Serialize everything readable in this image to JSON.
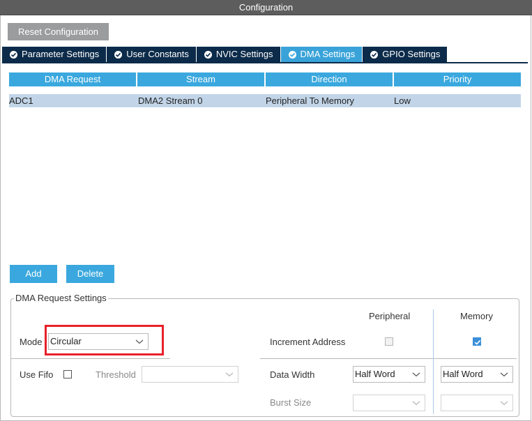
{
  "window": {
    "title": "Configuration"
  },
  "toolbar": {
    "reset_label": "Reset Configuration"
  },
  "tabs": [
    {
      "label": "Parameter Settings",
      "active": false
    },
    {
      "label": "User Constants",
      "active": false
    },
    {
      "label": "NVIC Settings",
      "active": false
    },
    {
      "label": "DMA Settings",
      "active": true
    },
    {
      "label": "GPIO Settings",
      "active": false
    }
  ],
  "table": {
    "columns": [
      "DMA Request",
      "Stream",
      "Direction",
      "Priority"
    ],
    "rows": [
      [
        "ADC1",
        "DMA2 Stream 0",
        "Peripheral To Memory",
        "Low"
      ]
    ]
  },
  "actions": {
    "add_label": "Add",
    "delete_label": "Delete"
  },
  "settings": {
    "group_title": "DMA Request Settings",
    "peripheral_header": "Peripheral",
    "memory_header": "Memory",
    "mode_label": "Mode",
    "mode_value": "Circular",
    "increment_label": "Increment Address",
    "peripheral_increment": false,
    "memory_increment": true,
    "use_fifo_label": "Use Fifo",
    "use_fifo": false,
    "threshold_label": "Threshold",
    "threshold_value": "",
    "data_width_label": "Data Width",
    "peripheral_data_width": "Half Word",
    "memory_data_width": "Half Word",
    "burst_size_label": "Burst Size",
    "peripheral_burst_size": "",
    "memory_burst_size": ""
  },
  "colors": {
    "accent": "#3aa8de",
    "tab_dark": "#0c2b4a",
    "selected_row": "#c2d5e8",
    "highlight": "#e8202a"
  }
}
